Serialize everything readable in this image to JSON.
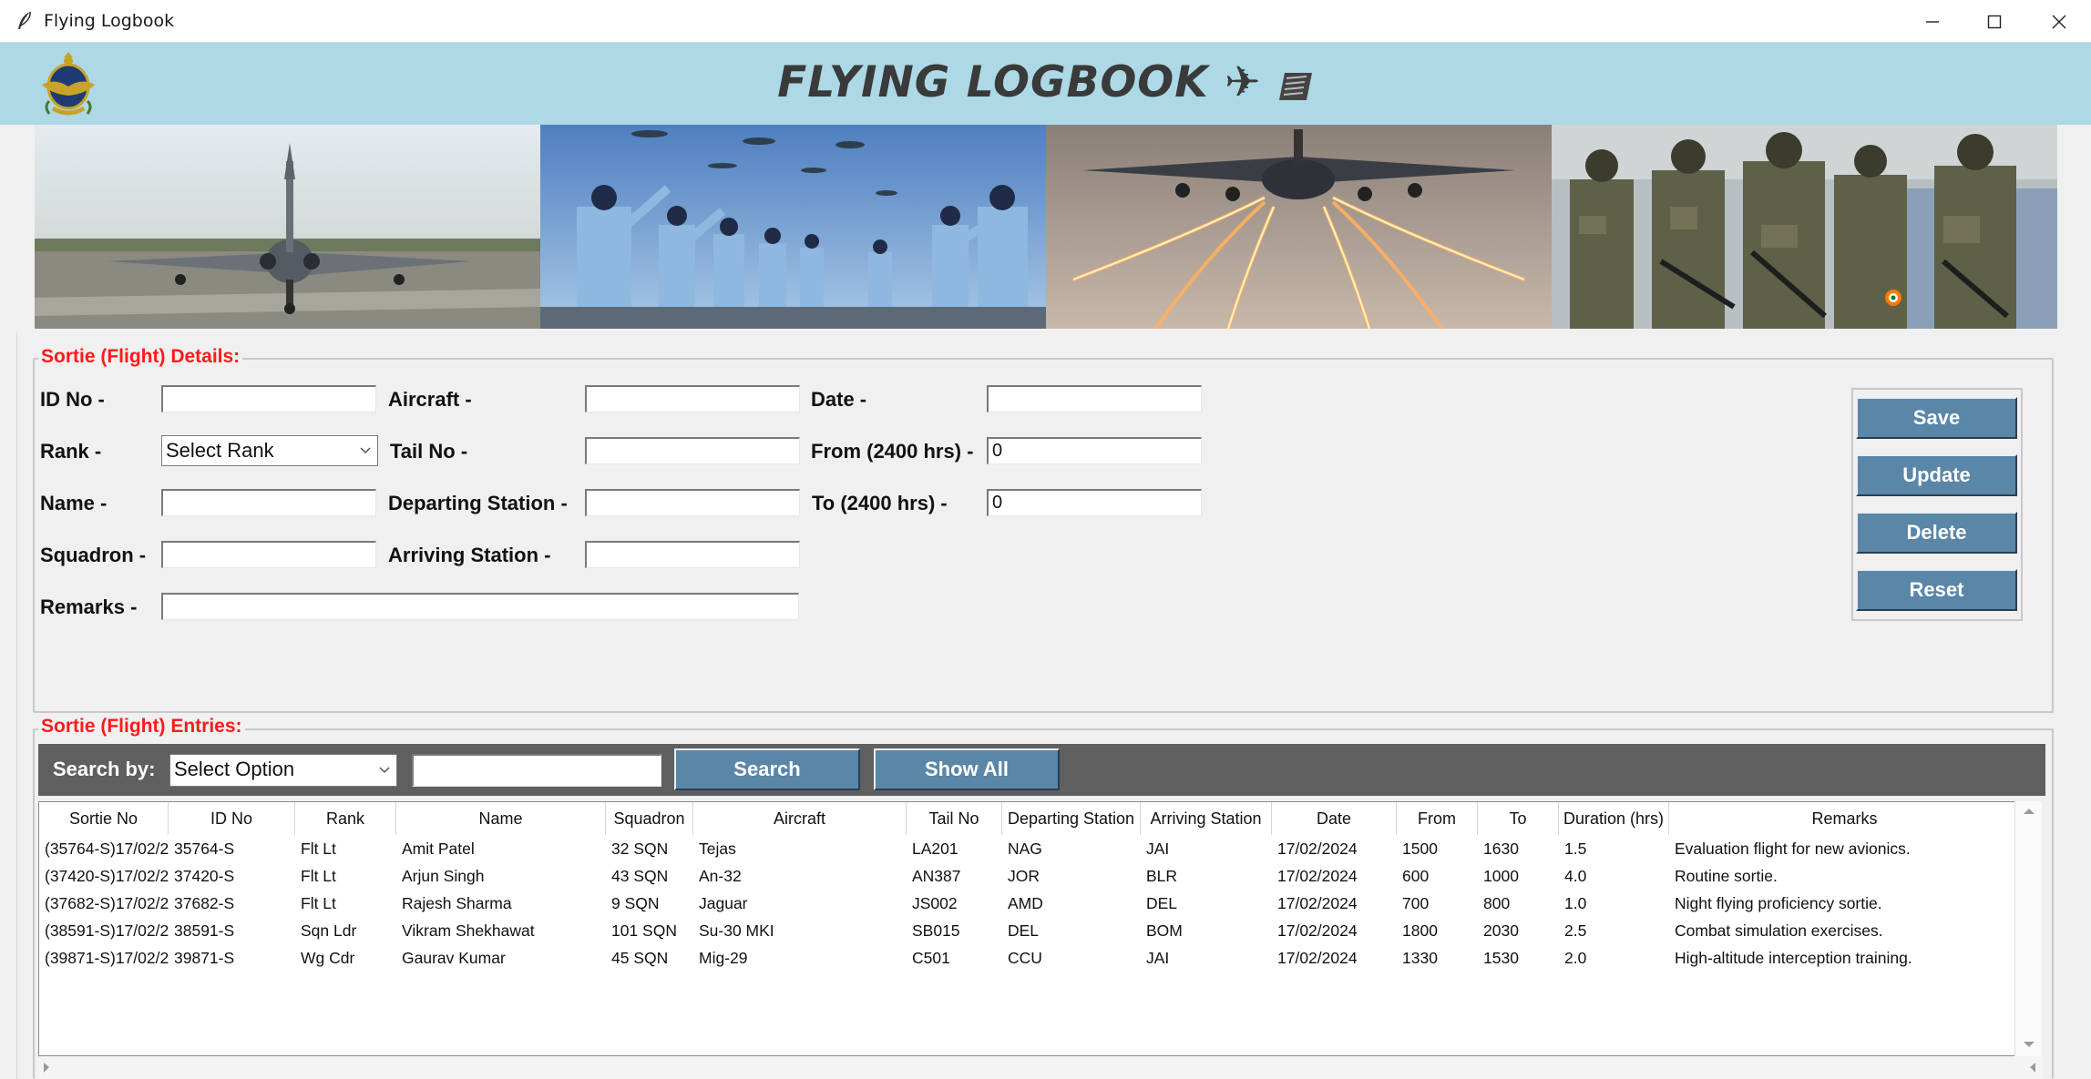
{
  "window": {
    "title": "Flying Logbook",
    "controls": {
      "minimize": "—",
      "maximize": "☐",
      "close": "✕"
    }
  },
  "header": {
    "title": "FLYING LOGBOOK ✈",
    "emblem_icon": "air-force-emblem",
    "banner_images": [
      "fighter-jet-runway",
      "airmen-parade",
      "transport-aircraft-flares",
      "commandos-vehicle"
    ]
  },
  "details": {
    "section_title": "Sortie (Flight) Details:",
    "fields": {
      "id_no": {
        "label": "ID No -",
        "value": ""
      },
      "rank": {
        "label": "Rank -",
        "value": "Select Rank"
      },
      "name": {
        "label": "Name -",
        "value": ""
      },
      "squadron": {
        "label": "Squadron -",
        "value": ""
      },
      "remarks": {
        "label": "Remarks -",
        "value": ""
      },
      "aircraft": {
        "label": "Aircraft -",
        "value": ""
      },
      "tail_no": {
        "label": "Tail No -",
        "value": ""
      },
      "departing_station": {
        "label": "Departing Station -",
        "value": ""
      },
      "arriving_station": {
        "label": "Arriving Station -",
        "value": ""
      },
      "date": {
        "label": "Date -",
        "value": ""
      },
      "from": {
        "label": "From (2400 hrs) -",
        "value": "0"
      },
      "to": {
        "label": "To (2400 hrs) -",
        "value": "0"
      }
    },
    "buttons": {
      "save": "Save",
      "update": "Update",
      "delete": "Delete",
      "reset": "Reset"
    }
  },
  "entries": {
    "section_title": "Sortie (Flight) Entries:",
    "search": {
      "label": "Search by:",
      "option": "Select Option",
      "value": "",
      "search_button": "Search",
      "show_all_button": "Show All"
    },
    "columns": [
      "Sortie No",
      "ID No",
      "Rank",
      "Name",
      "Squadron",
      "Aircraft",
      "Tail No",
      "Departing Station",
      "Arriving Station",
      "Date",
      "From",
      "To",
      "Duration (hrs)",
      "Remarks"
    ],
    "rows": [
      [
        "(35764-S)17/02/2",
        "35764-S",
        "Flt Lt",
        "Amit Patel",
        "32 SQN",
        "Tejas",
        "LA201",
        "NAG",
        "JAI",
        "17/02/2024",
        "1500",
        "1630",
        "1.5",
        "Evaluation flight for new avionics."
      ],
      [
        "(37420-S)17/02/2",
        "37420-S",
        "Flt Lt",
        "Arjun Singh",
        "43 SQN",
        "An-32",
        "AN387",
        "JOR",
        "BLR",
        "17/02/2024",
        "600",
        "1000",
        "4.0",
        "Routine sortie."
      ],
      [
        "(37682-S)17/02/2",
        "37682-S",
        "Flt Lt",
        "Rajesh Sharma",
        "9 SQN",
        "Jaguar",
        "JS002",
        "AMD",
        "DEL",
        "17/02/2024",
        "700",
        "800",
        "1.0",
        "Night flying proficiency sortie."
      ],
      [
        "(38591-S)17/02/2",
        "38591-S",
        "Sqn Ldr",
        "Vikram Shekhawat",
        "101 SQN",
        "Su-30 MKI",
        "SB015",
        "DEL",
        "BOM",
        "17/02/2024",
        "1800",
        "2030",
        "2.5",
        "Combat simulation exercises."
      ],
      [
        "(39871-S)17/02/2",
        "39871-S",
        "Wg Cdr",
        "Gaurav Kumar",
        "45 SQN",
        "Mig-29",
        "C501",
        "CCU",
        "JAI",
        "17/02/2024",
        "1330",
        "1530",
        "2.0",
        "High-altitude interception training."
      ]
    ]
  }
}
